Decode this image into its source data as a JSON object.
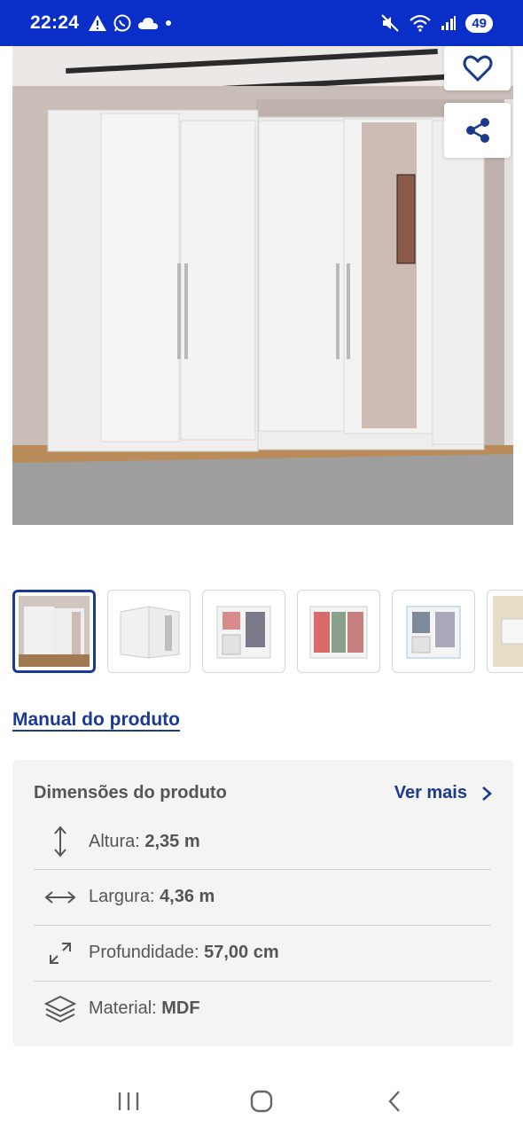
{
  "status": {
    "time": "22:24",
    "battery": "49"
  },
  "icons": {
    "alert": "warning-icon",
    "whatsapp": "whatsapp-icon",
    "cloud": "cloud-icon",
    "mute": "mute-icon",
    "wifi": "wifi-icon",
    "signal": "signal-icon",
    "favorite": "heart-icon",
    "share": "share-icon",
    "height": "vertical-arrows-icon",
    "width": "horizontal-arrows-icon",
    "depth": "diagonal-arrows-icon",
    "material": "layers-icon",
    "chevron": "chevron-right-icon"
  },
  "product": {
    "manual_link": "Manual do produto"
  },
  "dimensions": {
    "title": "Dimensões do produto",
    "see_more": "Ver mais",
    "rows": [
      {
        "label": "Altura: ",
        "value": "2,35 m"
      },
      {
        "label": "Largura: ",
        "value": "4,36 m"
      },
      {
        "label": "Profundidade: ",
        "value": "57,00 cm"
      },
      {
        "label": "Material: ",
        "value": "MDF"
      }
    ]
  },
  "colors": {
    "status_bar": "#0a2fc9",
    "link": "#1a3a8f",
    "card_bg": "#f4f4f4"
  }
}
